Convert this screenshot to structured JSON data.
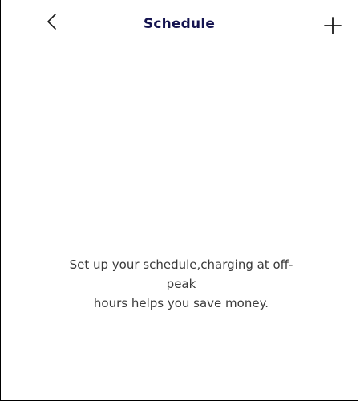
{
  "header": {
    "title": "Schedule",
    "back_icon": "chevron-left-icon",
    "add_icon": "plus-icon"
  },
  "empty_state": {
    "line1": "Set up your schedule,charging at off-",
    "line2": "peak",
    "line3": "hours helps you save money."
  },
  "colors": {
    "title": "#14134f",
    "body_text": "#3a3a3a",
    "background": "#ffffff"
  }
}
